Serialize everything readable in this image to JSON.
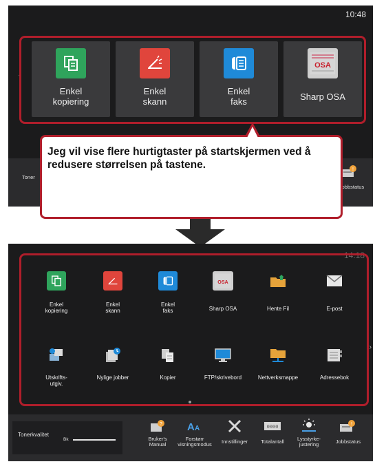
{
  "top_screen": {
    "clock": "10:48",
    "tiles": [
      {
        "label": "Enkel\nkopiering",
        "icon": "copy-icon"
      },
      {
        "label": "Enkel\nskann",
        "icon": "scan-icon"
      },
      {
        "label": "Enkel\nfaks",
        "icon": "fax-icon"
      },
      {
        "label": "Sharp OSA",
        "icon": "sharp-osa-icon"
      }
    ],
    "toner_label": "Toner",
    "job_status_label": "Jobbstatus"
  },
  "callout": {
    "text": "Jeg vil vise flere hurtigtaster på startskjermen ved å redusere størrelsen på tastene."
  },
  "bottom_screen": {
    "clock": "14:18",
    "tiles": [
      {
        "label": "Enkel\nkopiering",
        "icon": "copy-icon"
      },
      {
        "label": "Enkel\nskann",
        "icon": "scan-icon"
      },
      {
        "label": "Enkel\nfaks",
        "icon": "fax-icon"
      },
      {
        "label": "Sharp OSA",
        "icon": "sharp-osa-icon"
      },
      {
        "label": "Hente Fil",
        "icon": "folder-icon"
      },
      {
        "label": "E-post",
        "icon": "email-icon"
      },
      {
        "label": "Utskrifts-\nutgiv.",
        "icon": "print-release-icon"
      },
      {
        "label": "Nylige jobber",
        "icon": "recent-jobs-icon"
      },
      {
        "label": "Kopier",
        "icon": "copy-icon"
      },
      {
        "label": "FTP/skrivebord",
        "icon": "monitor-icon"
      },
      {
        "label": "Nettverksmappe",
        "icon": "network-folder-icon"
      },
      {
        "label": "Adressebok",
        "icon": "address-book-icon"
      }
    ],
    "toner_label": "Tonerkvalitet",
    "toner_channel": "Bk",
    "bar_items": [
      {
        "label": "Bruker's\nManual",
        "icon": "manual-icon"
      },
      {
        "label": "Forstørr\nvisningsmodus",
        "icon": "zoom-text-icon"
      },
      {
        "label": "Innstillinger",
        "icon": "settings-icon"
      },
      {
        "label": "Totalantall",
        "icon": "counter-icon"
      },
      {
        "label": "Lysstyrke-\njustering",
        "icon": "brightness-icon"
      },
      {
        "label": "Jobbstatus",
        "icon": "job-status-icon"
      }
    ]
  }
}
